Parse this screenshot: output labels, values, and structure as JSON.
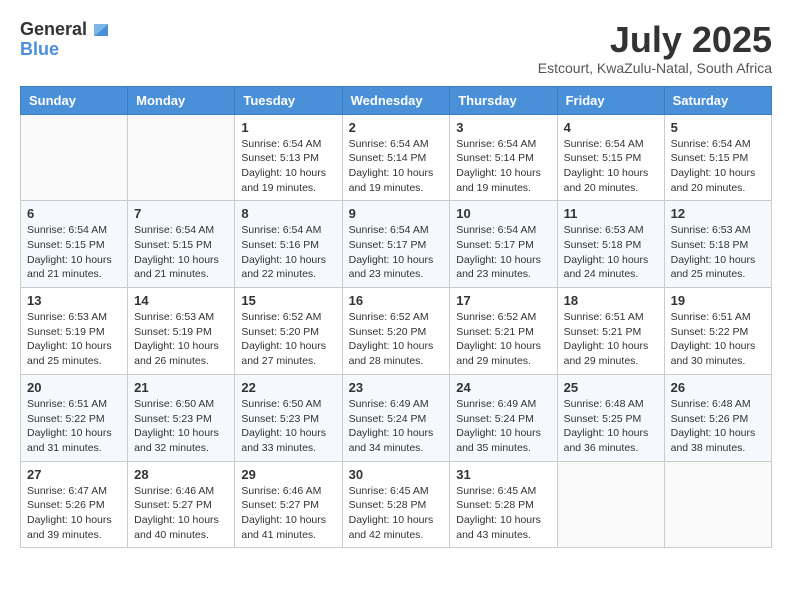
{
  "logo": {
    "general": "General",
    "blue": "Blue"
  },
  "title": "July 2025",
  "subtitle": "Estcourt, KwaZulu-Natal, South Africa",
  "days_of_week": [
    "Sunday",
    "Monday",
    "Tuesday",
    "Wednesday",
    "Thursday",
    "Friday",
    "Saturday"
  ],
  "weeks": [
    [
      {
        "day": "",
        "info": ""
      },
      {
        "day": "",
        "info": ""
      },
      {
        "day": "1",
        "info": "Sunrise: 6:54 AM\nSunset: 5:13 PM\nDaylight: 10 hours and 19 minutes."
      },
      {
        "day": "2",
        "info": "Sunrise: 6:54 AM\nSunset: 5:14 PM\nDaylight: 10 hours and 19 minutes."
      },
      {
        "day": "3",
        "info": "Sunrise: 6:54 AM\nSunset: 5:14 PM\nDaylight: 10 hours and 19 minutes."
      },
      {
        "day": "4",
        "info": "Sunrise: 6:54 AM\nSunset: 5:15 PM\nDaylight: 10 hours and 20 minutes."
      },
      {
        "day": "5",
        "info": "Sunrise: 6:54 AM\nSunset: 5:15 PM\nDaylight: 10 hours and 20 minutes."
      }
    ],
    [
      {
        "day": "6",
        "info": "Sunrise: 6:54 AM\nSunset: 5:15 PM\nDaylight: 10 hours and 21 minutes."
      },
      {
        "day": "7",
        "info": "Sunrise: 6:54 AM\nSunset: 5:15 PM\nDaylight: 10 hours and 21 minutes."
      },
      {
        "day": "8",
        "info": "Sunrise: 6:54 AM\nSunset: 5:16 PM\nDaylight: 10 hours and 22 minutes."
      },
      {
        "day": "9",
        "info": "Sunrise: 6:54 AM\nSunset: 5:17 PM\nDaylight: 10 hours and 23 minutes."
      },
      {
        "day": "10",
        "info": "Sunrise: 6:54 AM\nSunset: 5:17 PM\nDaylight: 10 hours and 23 minutes."
      },
      {
        "day": "11",
        "info": "Sunrise: 6:53 AM\nSunset: 5:18 PM\nDaylight: 10 hours and 24 minutes."
      },
      {
        "day": "12",
        "info": "Sunrise: 6:53 AM\nSunset: 5:18 PM\nDaylight: 10 hours and 25 minutes."
      }
    ],
    [
      {
        "day": "13",
        "info": "Sunrise: 6:53 AM\nSunset: 5:19 PM\nDaylight: 10 hours and 25 minutes."
      },
      {
        "day": "14",
        "info": "Sunrise: 6:53 AM\nSunset: 5:19 PM\nDaylight: 10 hours and 26 minutes."
      },
      {
        "day": "15",
        "info": "Sunrise: 6:52 AM\nSunset: 5:20 PM\nDaylight: 10 hours and 27 minutes."
      },
      {
        "day": "16",
        "info": "Sunrise: 6:52 AM\nSunset: 5:20 PM\nDaylight: 10 hours and 28 minutes."
      },
      {
        "day": "17",
        "info": "Sunrise: 6:52 AM\nSunset: 5:21 PM\nDaylight: 10 hours and 29 minutes."
      },
      {
        "day": "18",
        "info": "Sunrise: 6:51 AM\nSunset: 5:21 PM\nDaylight: 10 hours and 29 minutes."
      },
      {
        "day": "19",
        "info": "Sunrise: 6:51 AM\nSunset: 5:22 PM\nDaylight: 10 hours and 30 minutes."
      }
    ],
    [
      {
        "day": "20",
        "info": "Sunrise: 6:51 AM\nSunset: 5:22 PM\nDaylight: 10 hours and 31 minutes."
      },
      {
        "day": "21",
        "info": "Sunrise: 6:50 AM\nSunset: 5:23 PM\nDaylight: 10 hours and 32 minutes."
      },
      {
        "day": "22",
        "info": "Sunrise: 6:50 AM\nSunset: 5:23 PM\nDaylight: 10 hours and 33 minutes."
      },
      {
        "day": "23",
        "info": "Sunrise: 6:49 AM\nSunset: 5:24 PM\nDaylight: 10 hours and 34 minutes."
      },
      {
        "day": "24",
        "info": "Sunrise: 6:49 AM\nSunset: 5:24 PM\nDaylight: 10 hours and 35 minutes."
      },
      {
        "day": "25",
        "info": "Sunrise: 6:48 AM\nSunset: 5:25 PM\nDaylight: 10 hours and 36 minutes."
      },
      {
        "day": "26",
        "info": "Sunrise: 6:48 AM\nSunset: 5:26 PM\nDaylight: 10 hours and 38 minutes."
      }
    ],
    [
      {
        "day": "27",
        "info": "Sunrise: 6:47 AM\nSunset: 5:26 PM\nDaylight: 10 hours and 39 minutes."
      },
      {
        "day": "28",
        "info": "Sunrise: 6:46 AM\nSunset: 5:27 PM\nDaylight: 10 hours and 40 minutes."
      },
      {
        "day": "29",
        "info": "Sunrise: 6:46 AM\nSunset: 5:27 PM\nDaylight: 10 hours and 41 minutes."
      },
      {
        "day": "30",
        "info": "Sunrise: 6:45 AM\nSunset: 5:28 PM\nDaylight: 10 hours and 42 minutes."
      },
      {
        "day": "31",
        "info": "Sunrise: 6:45 AM\nSunset: 5:28 PM\nDaylight: 10 hours and 43 minutes."
      },
      {
        "day": "",
        "info": ""
      },
      {
        "day": "",
        "info": ""
      }
    ]
  ]
}
